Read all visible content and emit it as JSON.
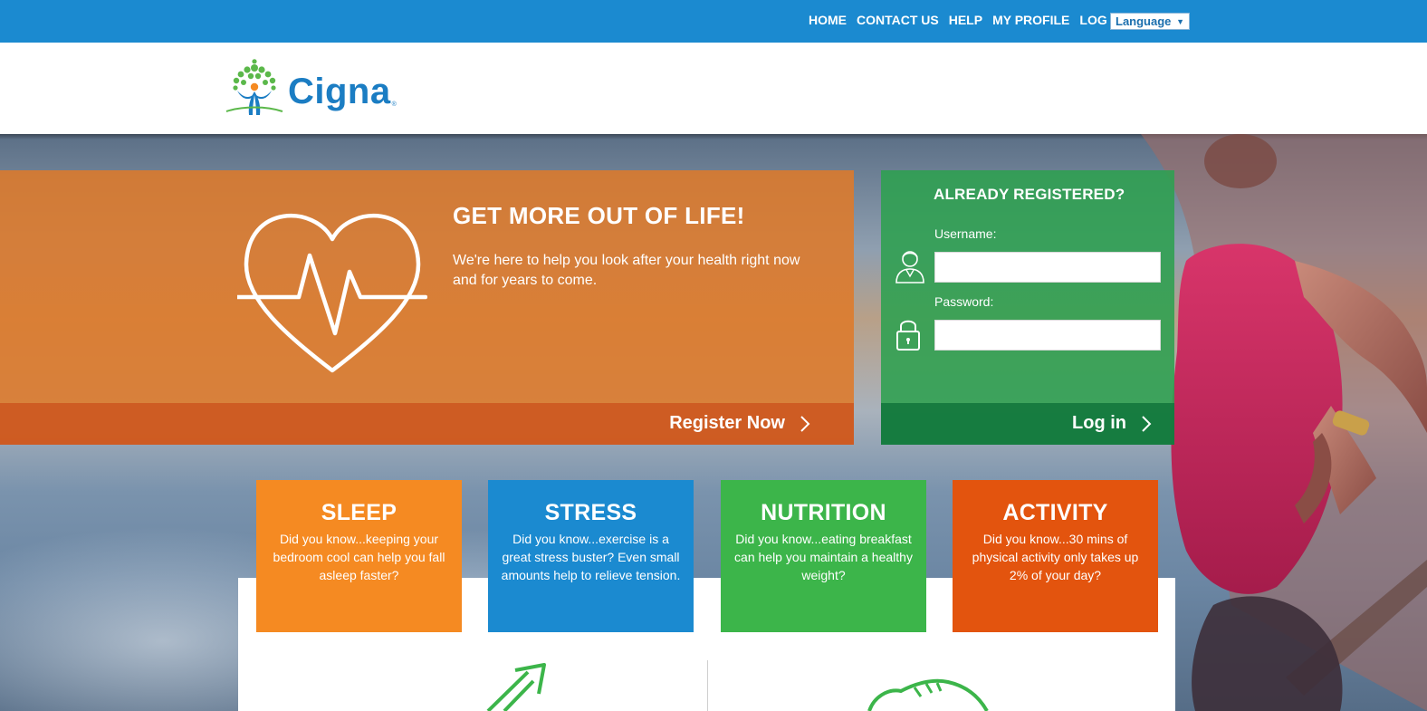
{
  "topnav": {
    "links": [
      "HOME",
      "CONTACT US",
      "HELP",
      "MY PROFILE",
      "LOG IN"
    ],
    "language_label": "Language"
  },
  "header": {
    "logo_text": "Cigna",
    "logo_reg": "®"
  },
  "promo": {
    "title": "GET MORE OUT OF LIFE!",
    "text": "We're here to help you look after your health right now and for years to come.",
    "register_label": "Register Now"
  },
  "login": {
    "title": "ALREADY REGISTERED?",
    "username_label": "Username:",
    "password_label": "Password:",
    "username_value": "",
    "password_value": "",
    "button_label": "Log in"
  },
  "tiles": [
    {
      "title": "SLEEP",
      "text": "Did you know...keeping your bedroom cool can help you fall asleep faster?",
      "color": "#f58a22"
    },
    {
      "title": "STRESS",
      "text": "Did you know...exercise is a great stress buster? Even small amounts help to relieve tension.",
      "color": "#1b8ad0"
    },
    {
      "title": "NUTRITION",
      "text": "Did you know...eating breakfast can help you maintain a healthy weight?",
      "color": "#3cb54a"
    },
    {
      "title": "ACTIVITY",
      "text": "Did you know...30 mins of physical activity only takes up 2% of your day?",
      "color": "#e3540e"
    }
  ],
  "colors": {
    "topbar": "#1b8ad0",
    "promo": "#de7a2a",
    "login": "#2ea050",
    "brand_blue": "#1b7dc3",
    "brand_green": "#5bb84a"
  }
}
